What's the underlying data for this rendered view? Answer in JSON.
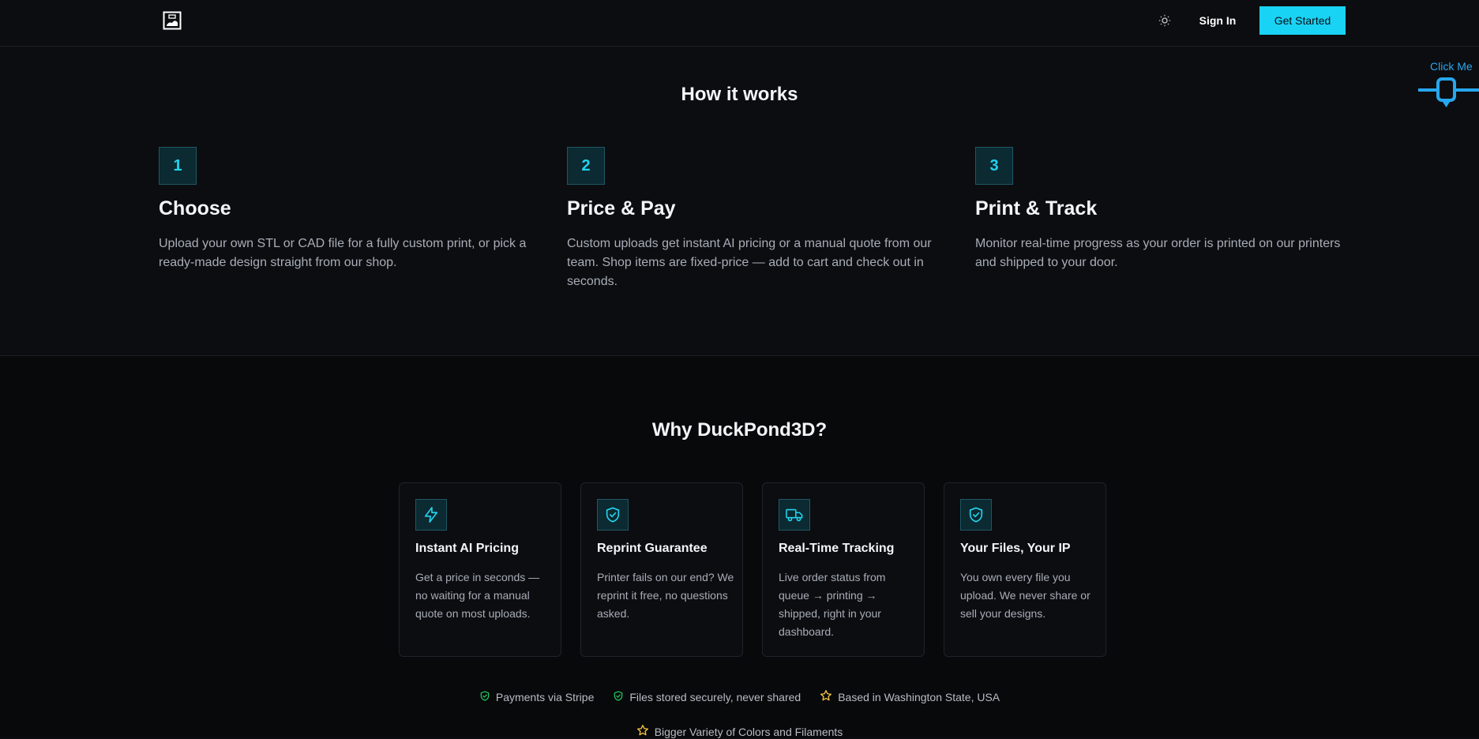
{
  "header": {
    "logo_icon": "duck-box-logo-icon",
    "theme_icon": "sun-icon",
    "sign_in": "Sign In",
    "get_started": "Get Started"
  },
  "widget": {
    "label": "Click Me",
    "icon": "slider-marker-icon"
  },
  "how": {
    "title": "How it works",
    "steps": [
      {
        "num": "1",
        "title": "Choose",
        "desc": "Upload your own STL or CAD file for a fully custom print, or pick a ready-made design straight from our shop."
      },
      {
        "num": "2",
        "title": "Price & Pay",
        "desc": "Custom uploads get instant AI pricing or a manual quote from our team. Shop items are fixed-price — add to cart and check out in seconds."
      },
      {
        "num": "3",
        "title": "Print & Track",
        "desc": "Monitor real-time progress as your order is printed on our printers and shipped to your door."
      }
    ]
  },
  "why": {
    "title": "Why DuckPond3D?",
    "cards": [
      {
        "icon": "lightning-icon",
        "title": "Instant AI Pricing",
        "desc": "Get a price in seconds — no waiting for a manual quote on most uploads."
      },
      {
        "icon": "shield-check-icon",
        "title": "Reprint Guarantee",
        "desc": "Printer fails on our end? We reprint it free, no questions asked."
      },
      {
        "icon": "truck-icon",
        "title": "Real-Time Tracking",
        "desc": "Live order status from queue → printing → shipped, right in your dashboard."
      },
      {
        "icon": "shield-check-icon",
        "title": "Your Files, Your IP",
        "desc": "You own every file you upload. We never share or sell your designs."
      }
    ]
  },
  "badges": [
    {
      "icon": "shield-check-icon",
      "label": "Payments via Stripe"
    },
    {
      "icon": "shield-check-icon",
      "label": "Files stored securely, never shared"
    },
    {
      "icon": "star-icon",
      "label": "Based in Washington State, USA"
    },
    {
      "icon": "star-icon",
      "label": "Bigger Variety of Colors and Filaments"
    }
  ],
  "colors": {
    "accent": "#19d3f5",
    "widget_blue": "#27a7ef",
    "badge_green": "#22c55e",
    "badge_star": "#f5c542",
    "background": "#0c0d10"
  }
}
